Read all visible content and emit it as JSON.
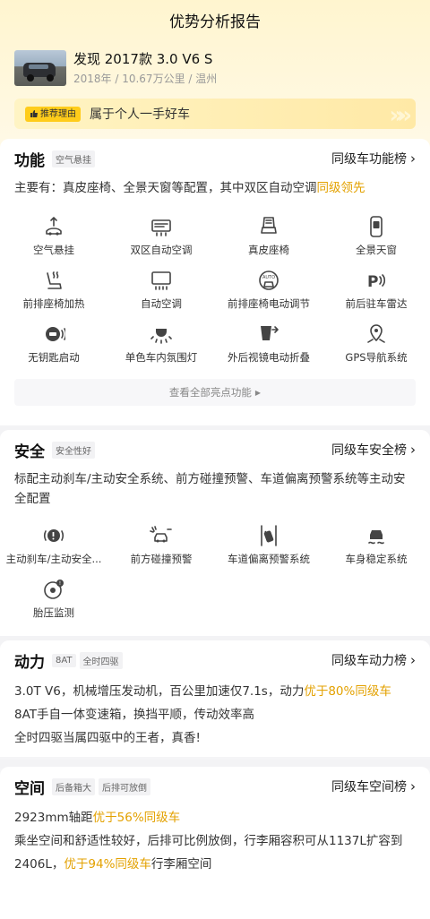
{
  "header": {
    "title": "优势分析报告"
  },
  "car": {
    "name": "发现 2017款 3.0 V6 S",
    "meta": "2018年 / 10.67万公里 / 温州"
  },
  "reason": {
    "tag": "推荐理由",
    "text": "属于个人一手好车"
  },
  "func": {
    "title": "功能",
    "chip": "空气悬挂",
    "rank": "同级车功能榜",
    "desc_prefix": "主要有：真皮座椅、全景天窗等配置，其中双区自动空调",
    "desc_hl": "同级领先",
    "items": [
      "空气悬挂",
      "双区自动空调",
      "真皮座椅",
      "全景天窗",
      "前排座椅加热",
      "自动空调",
      "前排座椅电动调节",
      "前后驻车雷达",
      "无钥匙启动",
      "单色车内氛围灯",
      "外后视镜电动折叠",
      "GPS导航系统"
    ],
    "icons": [
      "suspension-icon",
      "dual-zone-ac-icon",
      "leather-seat-icon",
      "panoramic-sunroof-icon",
      "seat-heating-icon",
      "auto-ac-icon",
      "power-seat-icon",
      "parking-radar-icon",
      "keyless-start-icon",
      "ambient-light-icon",
      "mirror-fold-icon",
      "gps-nav-icon"
    ],
    "more": "查看全部亮点功能"
  },
  "safety": {
    "title": "安全",
    "chip": "安全性好",
    "rank": "同级车安全榜",
    "desc": "标配主动刹车/主动安全系统、前方碰撞预警、车道偏离预警系统等主动安全配置",
    "items": [
      "主动刹车/主动安全...",
      "前方碰撞预警",
      "车道偏离预警系统",
      "车身稳定系统",
      "胎压监测"
    ],
    "icons": [
      "active-brake-icon",
      "collision-warning-icon",
      "lane-departure-icon",
      "stability-control-icon",
      "tire-pressure-icon"
    ]
  },
  "power": {
    "title": "动力",
    "chip1": "8AT",
    "chip2": "全时四驱",
    "rank": "同级车动力榜",
    "line1_prefix": "3.0T V6，机械增压发动机，百公里加速仅7.1s，动力",
    "line1_hl": "优于80%同级车",
    "line2": "8AT手自一体变速箱，换挡平顺，传动效率高",
    "line3": "全时四驱当属四驱中的王者，真香!"
  },
  "space": {
    "title": "空间",
    "chip1": "后备箱大",
    "chip2": "后排可放倒",
    "rank": "同级车空间榜",
    "line1_prefix": "2923mm轴距",
    "line1_hl": "优于56%同级车",
    "line2": "乘坐空间和舒适性较好，后排可比例放倒，行李厢容积可从1137L扩容到",
    "line3_prefix": "2406L，",
    "line3_hl": "优于94%同级车",
    "line3_suffix": "行李厢空间"
  }
}
